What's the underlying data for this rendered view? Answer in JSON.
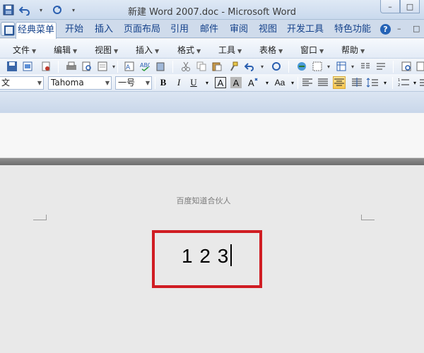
{
  "window": {
    "title": "新建 Word 2007.doc - Microsoft Word",
    "buttons": {
      "minimize": "–",
      "maximize": "□"
    }
  },
  "ribbon": {
    "tabs": [
      "经典菜单",
      "开始",
      "插入",
      "页面布局",
      "引用",
      "邮件",
      "审阅",
      "视图",
      "开发工具",
      "特色功能"
    ],
    "active_tab": "经典菜单",
    "help": "?",
    "mdi_min": "–",
    "mdi_max": "□"
  },
  "menubar": {
    "items": [
      "文件",
      "编辑",
      "视图",
      "插入",
      "格式",
      "工具",
      "表格",
      "窗口",
      "帮助"
    ],
    "arrow": "▼"
  },
  "format_toolbar": {
    "style_value": "文",
    "font_value": "Tahoma",
    "size_value": "一号",
    "bold": "B",
    "italic": "I",
    "underline": "U",
    "char_border": "A",
    "char_shading": "A",
    "case": "Aa",
    "dropdown_arrow": "▼"
  },
  "document": {
    "header": "百度知道合伙人",
    "body_text": "1 2 3"
  },
  "colors": {
    "highlight_border": "#d01d23",
    "ribbon_blue": "#15428b"
  },
  "icons": [
    "app-icon",
    "save-icon",
    "undo-icon",
    "redo-icon",
    "open-icon",
    "print-icon",
    "print-preview-icon",
    "cut-icon",
    "copy-icon",
    "paste-icon",
    "format-painter-icon",
    "align-left-icon",
    "align-center-icon",
    "align-right-icon",
    "justify-icon",
    "line-spacing-icon",
    "bullets-icon",
    "help-icon"
  ]
}
